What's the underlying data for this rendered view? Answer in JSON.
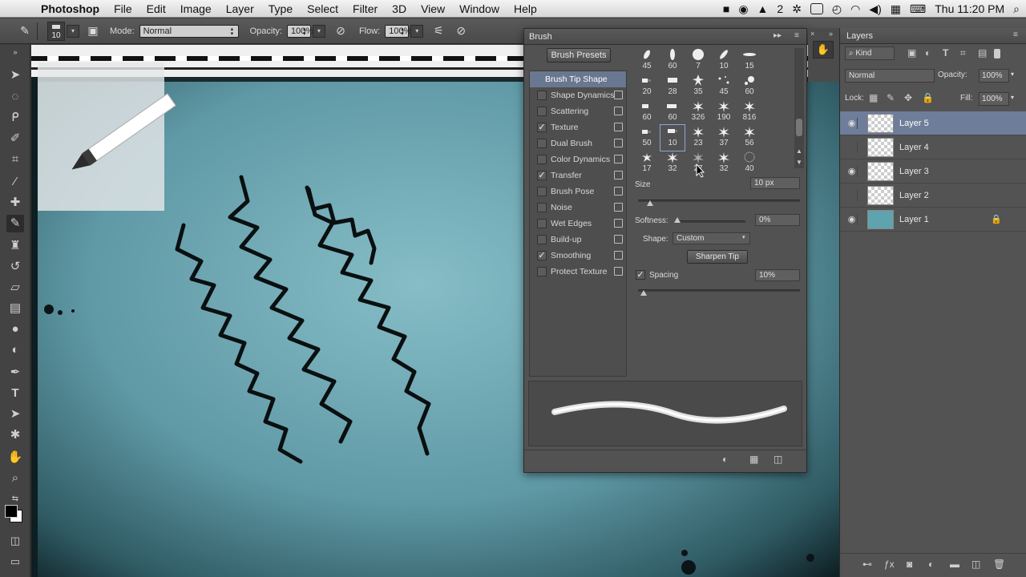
{
  "menubar": {
    "app": "Photoshop",
    "items": [
      "File",
      "Edit",
      "Image",
      "Layer",
      "Type",
      "Select",
      "Filter",
      "3D",
      "View",
      "Window",
      "Help"
    ],
    "adobe_badge": "2",
    "clock": "Thu 11:20 PM"
  },
  "options": {
    "brush_size": "10",
    "mode_label": "Mode:",
    "mode_value": "Normal",
    "opacity_label": "Opacity:",
    "opacity_value": "100%",
    "flow_label": "Flow:",
    "flow_value": "100%"
  },
  "brush_panel": {
    "tab": "Brush",
    "presets_button": "Brush Presets",
    "left_items": [
      {
        "label": "Brush Tip Shape",
        "checked": null
      },
      {
        "label": "Shape Dynamics",
        "checked": false
      },
      {
        "label": "Scattering",
        "checked": false
      },
      {
        "label": "Texture",
        "checked": true
      },
      {
        "label": "Dual Brush",
        "checked": false
      },
      {
        "label": "Color Dynamics",
        "checked": false
      },
      {
        "label": "Transfer",
        "checked": true
      },
      {
        "label": "Brush Pose",
        "checked": false
      },
      {
        "label": "Noise",
        "checked": false
      },
      {
        "label": "Wet Edges",
        "checked": false
      },
      {
        "label": "Build-up",
        "checked": false
      },
      {
        "label": "Smoothing",
        "checked": true
      },
      {
        "label": "Protect Texture",
        "checked": false
      }
    ],
    "tip_sizes": [
      [
        "45",
        "60",
        "7",
        "10",
        "15"
      ],
      [
        "20",
        "28",
        "35",
        "45",
        "60"
      ],
      [
        "60",
        "60",
        "326",
        "190",
        "816"
      ],
      [
        "50",
        "10",
        "23",
        "37",
        "56"
      ],
      [
        "17",
        "32",
        "27",
        "32",
        "40"
      ]
    ],
    "size_label": "Size",
    "size_value": "10 px",
    "softness_label": "Softness:",
    "softness_value": "0%",
    "shape_label": "Shape:",
    "shape_value": "Custom",
    "sharpen_button": "Sharpen Tip",
    "spacing_label": "Spacing",
    "spacing_value": "10%"
  },
  "layers_panel": {
    "tab": "Layers",
    "kind_filter": "Kind",
    "blend_mode": "Normal",
    "opacity_label": "Opacity:",
    "opacity_value": "100%",
    "lock_label": "Lock:",
    "fill_label": "Fill:",
    "fill_value": "100%",
    "layers": [
      {
        "name": "Layer 5",
        "visible": true,
        "selected": true
      },
      {
        "name": "Layer 4",
        "visible": false,
        "selected": false
      },
      {
        "name": "Layer 3",
        "visible": true,
        "selected": false
      },
      {
        "name": "Layer 2",
        "visible": false,
        "selected": false
      },
      {
        "name": "Layer 1",
        "visible": true,
        "selected": false,
        "locked": true
      }
    ]
  },
  "colors": {
    "canvas_teal": "#7bb4bf",
    "panel_bg": "#525252",
    "selection_blue": "#6e7d99"
  }
}
